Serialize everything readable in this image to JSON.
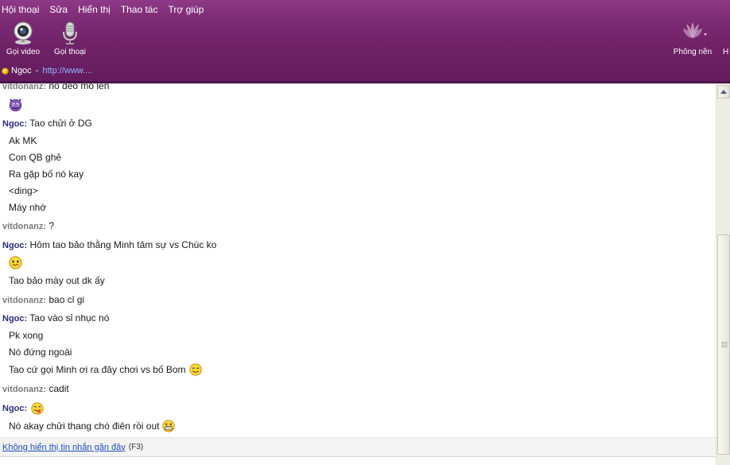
{
  "menu": [
    "Hội thoại",
    "Sửa",
    "Hiển thị",
    "Thao tác",
    "Trợ giúp"
  ],
  "toolbar": {
    "video_call": "Gọi video",
    "voice_call": "Gọi thoại",
    "background": "Phông nền",
    "cut_label": "H"
  },
  "status": {
    "name": "Ngoc",
    "dash": "-",
    "link": "http://www...."
  },
  "colors": {
    "header": "#6e2167",
    "sender_them": "#7a7a7a",
    "sender_me": "#2b2b80",
    "link": "#1a4fbf"
  },
  "messages": [
    {
      "sender": "vitdonanz:",
      "text": "nó đèo mồ  lên"
    },
    {
      "emoticon": "devil-icon"
    },
    {
      "sender": "Ngoc:",
      "text": "Tao chửi ở DG"
    },
    {
      "text": "Ak MK"
    },
    {
      "text": "Con QB ghẻ"
    },
    {
      "text": "Ra gặp bố nó kay"
    },
    {
      "text": "<ding>"
    },
    {
      "text": "Máy nhớ"
    },
    {
      "sender": "vitdonanz:",
      "text": "?"
    },
    {
      "sender": "Ngoc:",
      "text": "Hôm tao bảo thằng Minh tâm sự vs Chúc ko"
    },
    {
      "emoticon": "confused-smiley-icon"
    },
    {
      "text": "Tao bảo mày out dk ấy"
    },
    {
      "sender": "vitdonanz:",
      "text": "bao cl gi"
    },
    {
      "sender": "Ngoc:",
      "text": "Tao vào sỉ nhục nó"
    },
    {
      "text": "Pk xong"
    },
    {
      "text": "Nó đứng ngoài"
    },
    {
      "text": "Tao cứ gọi Minh ơi ra đây chơi vs bố Bom",
      "emoticon": "smiley-icon"
    },
    {
      "sender": "vitdonanz:",
      "text": "cadit"
    },
    {
      "sender": "Ngoc:",
      "emoticon": "tongue-out-icon"
    },
    {
      "text": "Nó akay chửi thang chó điên rồi out",
      "emoticon": "big-grin-icon"
    }
  ],
  "footer": {
    "link": "Không hiển thị tin nhắn gần đây",
    "hint": "(F3)"
  }
}
